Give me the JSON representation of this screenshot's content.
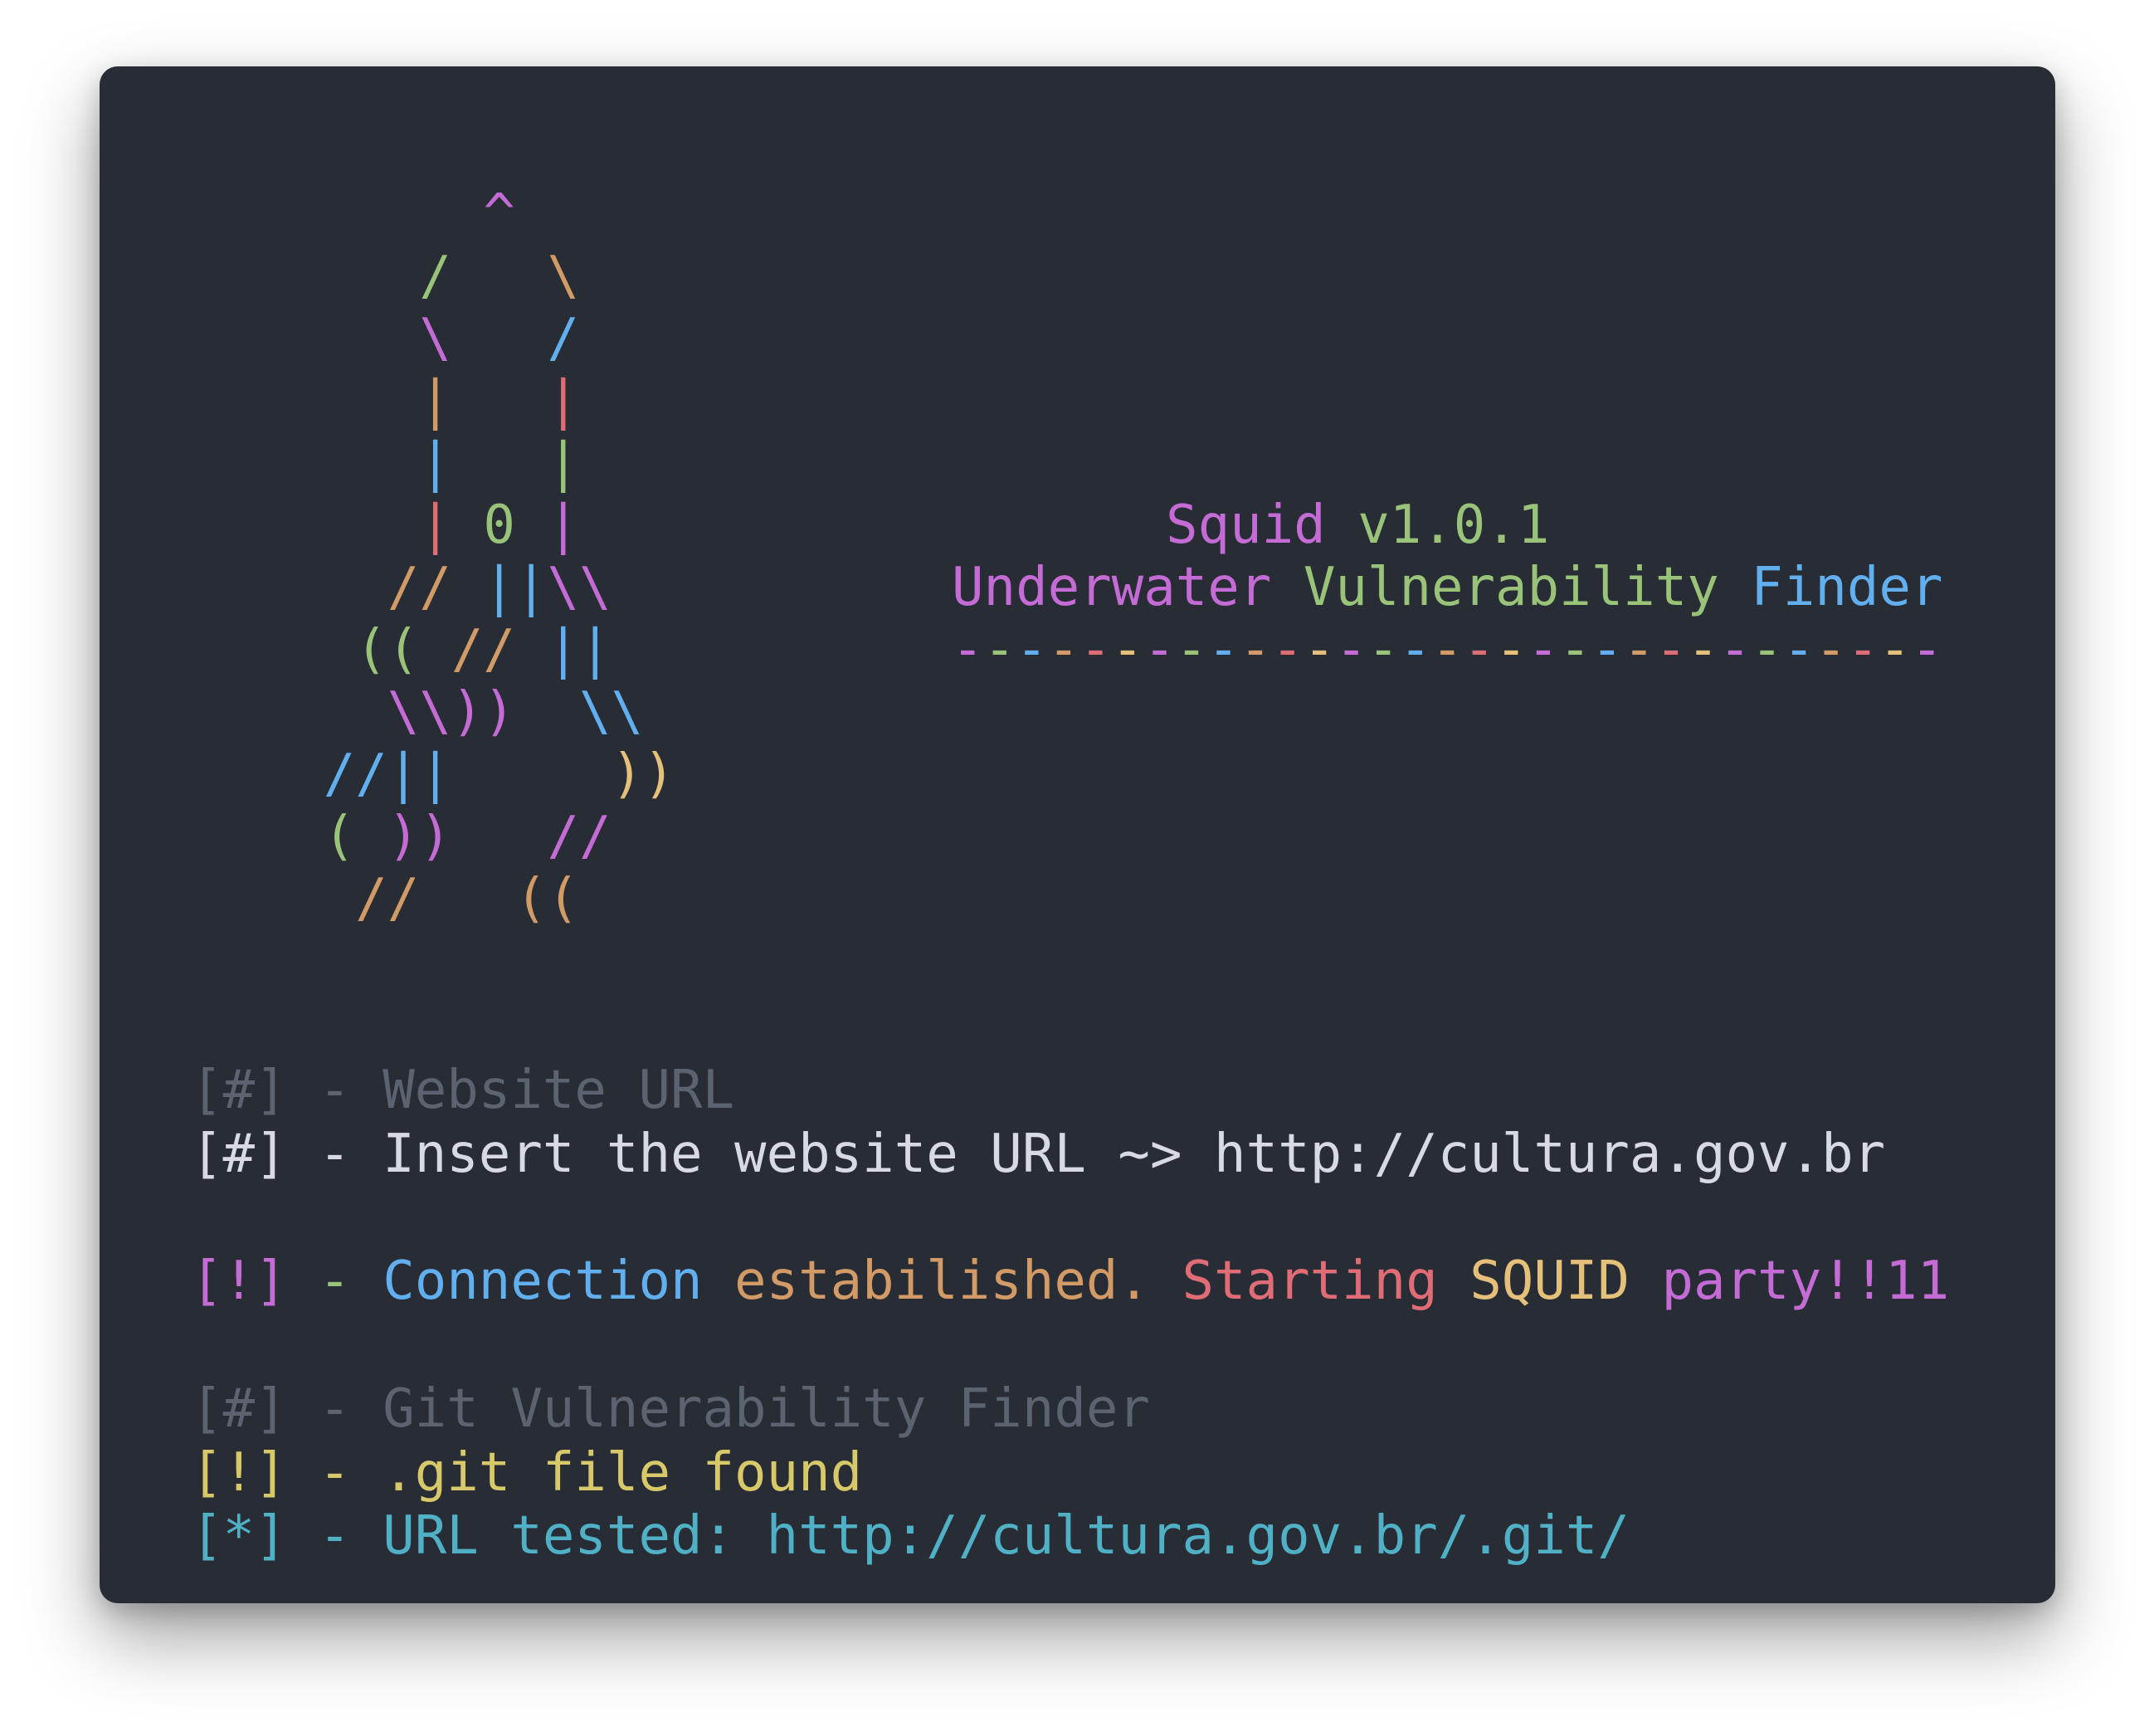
{
  "art": {
    "lines": [
      [
        "            ",
        "^"
      ],
      [
        "          ",
        "/",
        "   ",
        "\\"
      ],
      [
        "          ",
        "\\",
        "   ",
        "/"
      ],
      [
        "          ",
        "|",
        "   ",
        "|"
      ],
      [
        "          ",
        "|",
        "   ",
        "|"
      ],
      [
        "          ",
        "|",
        " ",
        "0",
        " ",
        "|"
      ],
      [
        "         ",
        "//",
        " ",
        "||",
        "\\\\"
      ],
      [
        "        ",
        "((",
        " ",
        "//",
        " ",
        "||"
      ],
      [
        "         ",
        "\\\\))",
        "  ",
        "\\\\"
      ],
      [
        "       ",
        "//||",
        "     ",
        "))"
      ],
      [
        "       ",
        "(",
        " ",
        "))",
        "   ",
        "//"
      ],
      [
        "        ",
        "//",
        "   ",
        "(("
      ]
    ]
  },
  "header": {
    "title": "Squid v1.0.1",
    "subtitle": "Underwater Vulnerability Finder",
    "divider": "-------------------------------"
  },
  "output": {
    "website_section": "[#] - Website URL",
    "prompt_prefix": "[#] - Insert the website URL ~> ",
    "prompt_value": "http://cultura.gov.br",
    "connection_message": "[!] - Connection estabilished. Starting SQUID party!!11",
    "git_section": "[#] - Git Vulnerability Finder",
    "git_found": "[!] - .git file found",
    "url_tested_prefix": "[*] - URL tested: ",
    "url_tested_value": "http://cultura.gov.br/.git/"
  },
  "colors": {
    "background": "#282c34",
    "text": "#d7dae0",
    "muted": "#5c6370",
    "yellow": "#d7c86a",
    "cyan": "#4fb0c6",
    "rainbow": [
      "#c46bd6",
      "#98c379",
      "#61afef",
      "#d19a66",
      "#e06c75",
      "#e5c07b"
    ]
  }
}
